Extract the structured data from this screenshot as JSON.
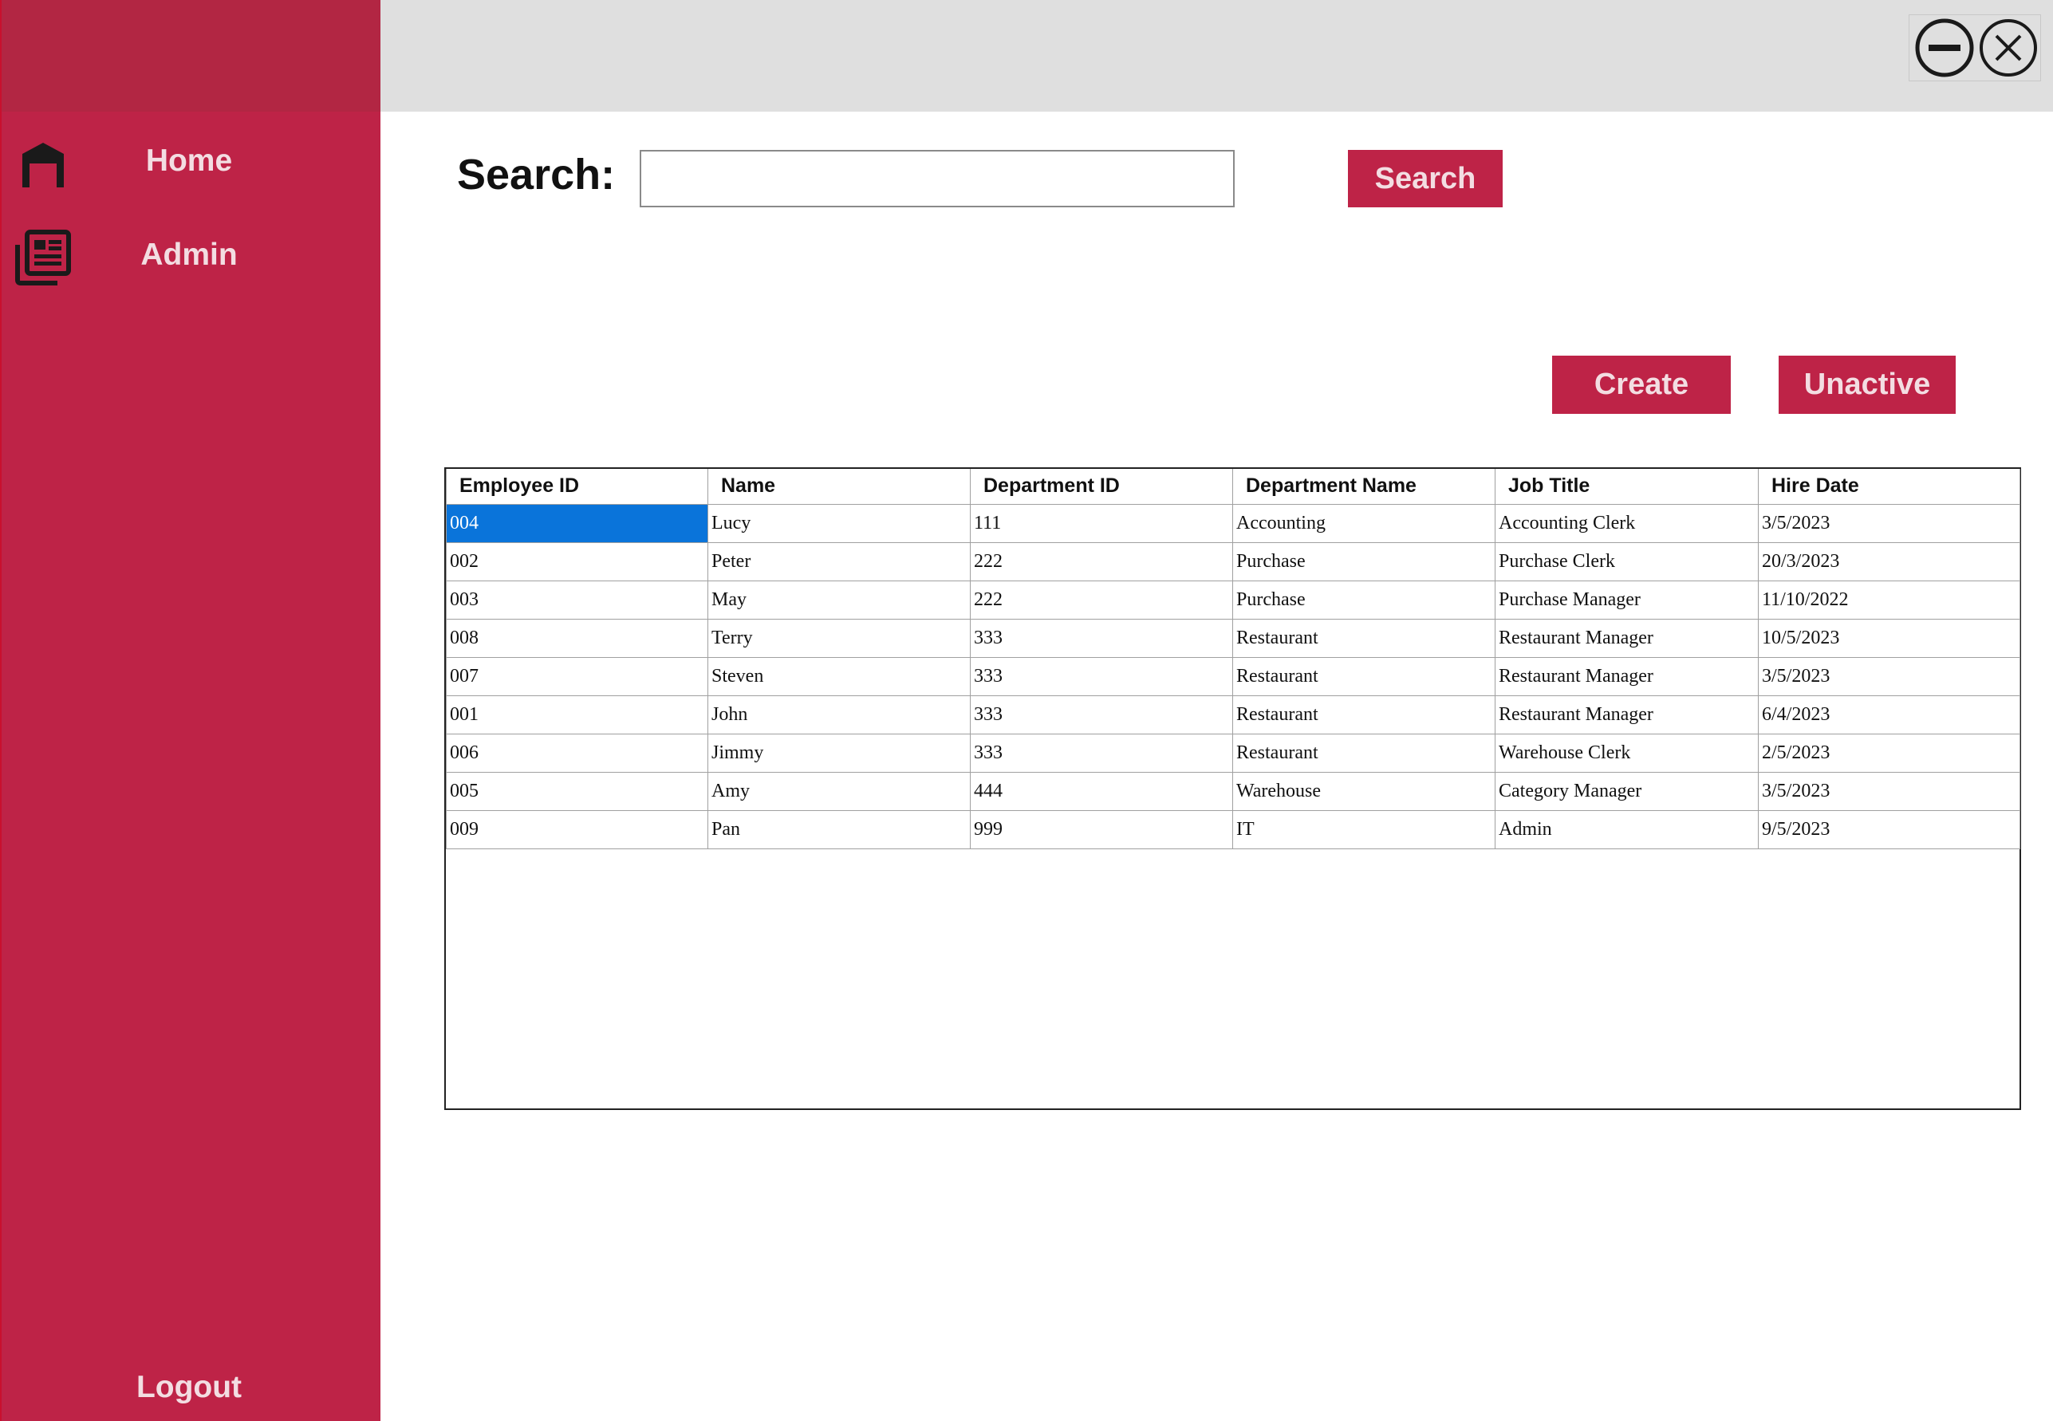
{
  "sidebar": {
    "items": [
      {
        "label": "Home",
        "icon": "garage-icon"
      },
      {
        "label": "Admin",
        "icon": "newspaper-icon"
      }
    ],
    "logout_label": "Logout"
  },
  "window": {
    "minimize_icon": "minimize-icon",
    "close_icon": "close-icon"
  },
  "search": {
    "label": "Search:",
    "value": "",
    "button_label": "Search"
  },
  "actions": {
    "create_label": "Create",
    "unactive_label": "Unactive"
  },
  "table": {
    "columns": [
      "Employee ID",
      "Name",
      "Department ID",
      "Department Name",
      "Job Title",
      "Hire Date"
    ],
    "rows": [
      [
        "004",
        "Lucy",
        "111",
        "Accounting",
        "Accounting Clerk",
        "3/5/2023"
      ],
      [
        "002",
        "Peter",
        "222",
        "Purchase",
        "Purchase Clerk",
        "20/3/2023"
      ],
      [
        "003",
        "May",
        "222",
        "Purchase",
        "Purchase Manager",
        "11/10/2022"
      ],
      [
        "008",
        "Terry",
        "333",
        "Restaurant",
        "Restaurant Manager",
        "10/5/2023"
      ],
      [
        "007",
        "Steven",
        "333",
        "Restaurant",
        "Restaurant Manager",
        "3/5/2023"
      ],
      [
        "001",
        "John",
        "333",
        "Restaurant",
        "Restaurant Manager",
        "6/4/2023"
      ],
      [
        "006",
        "Jimmy",
        "333",
        "Restaurant",
        "Warehouse Clerk",
        "2/5/2023"
      ],
      [
        "005",
        "Amy",
        "444",
        "Warehouse",
        "Category Manager",
        "3/5/2023"
      ],
      [
        "009",
        "Pan",
        "999",
        "IT",
        "Admin",
        "9/5/2023"
      ]
    ],
    "selected_row": 0
  },
  "colors": {
    "brand": "#be2347",
    "sidebar_header": "#b22643",
    "titlebar": "#dfdfdf",
    "selection": "#0a74da"
  }
}
